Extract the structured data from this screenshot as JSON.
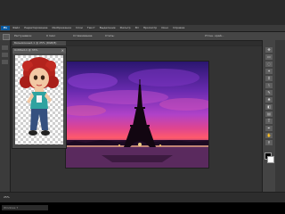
{
  "app": {
    "logo": "Ps"
  },
  "menubar": {
    "items": [
      "Файл",
      "Редактирование",
      "Изображение",
      "Слои",
      "Текст",
      "Выделение",
      "Фильтр",
      "3D",
      "Просмотр",
      "Окно",
      "Справка"
    ]
  },
  "options": {
    "field1": "Растушевка:",
    "field1_value": "0 пикс",
    "field2": "Сглаживание",
    "field3": "Стиль:",
    "field4": "Уточн. край..."
  },
  "doc_tab": {
    "label": "Безымянный-1 @ 25% (RGB/8)"
  },
  "floating_doc": {
    "title": "Untitled-1 @ 33%",
    "close": "×"
  },
  "status": {
    "zoom": "25%"
  },
  "taskbar": {
    "item": "Windows 7"
  },
  "colors": {
    "accent": "#0b5aa0",
    "foreground_swatch": "#000000",
    "background_swatch": "#ffffff"
  },
  "right_tools": [
    {
      "icon": "move-icon",
      "glyph": "✥"
    },
    {
      "icon": "marquee-icon",
      "glyph": "▭"
    },
    {
      "icon": "lasso-icon",
      "glyph": "◌"
    },
    {
      "icon": "wand-icon",
      "glyph": "✦"
    },
    {
      "icon": "crop-icon",
      "glyph": "⌗"
    },
    {
      "icon": "eyedropper-icon",
      "glyph": "⌇"
    },
    {
      "icon": "brush-icon",
      "glyph": "✎"
    },
    {
      "icon": "stamp-icon",
      "glyph": "♣"
    },
    {
      "icon": "eraser-icon",
      "glyph": "◧"
    },
    {
      "icon": "gradient-icon",
      "glyph": "▤"
    },
    {
      "icon": "text-icon",
      "glyph": "T"
    },
    {
      "icon": "pen-icon",
      "glyph": "✒"
    },
    {
      "icon": "hand-icon",
      "glyph": "✋"
    },
    {
      "icon": "zoom-icon",
      "glyph": "⚲"
    }
  ]
}
